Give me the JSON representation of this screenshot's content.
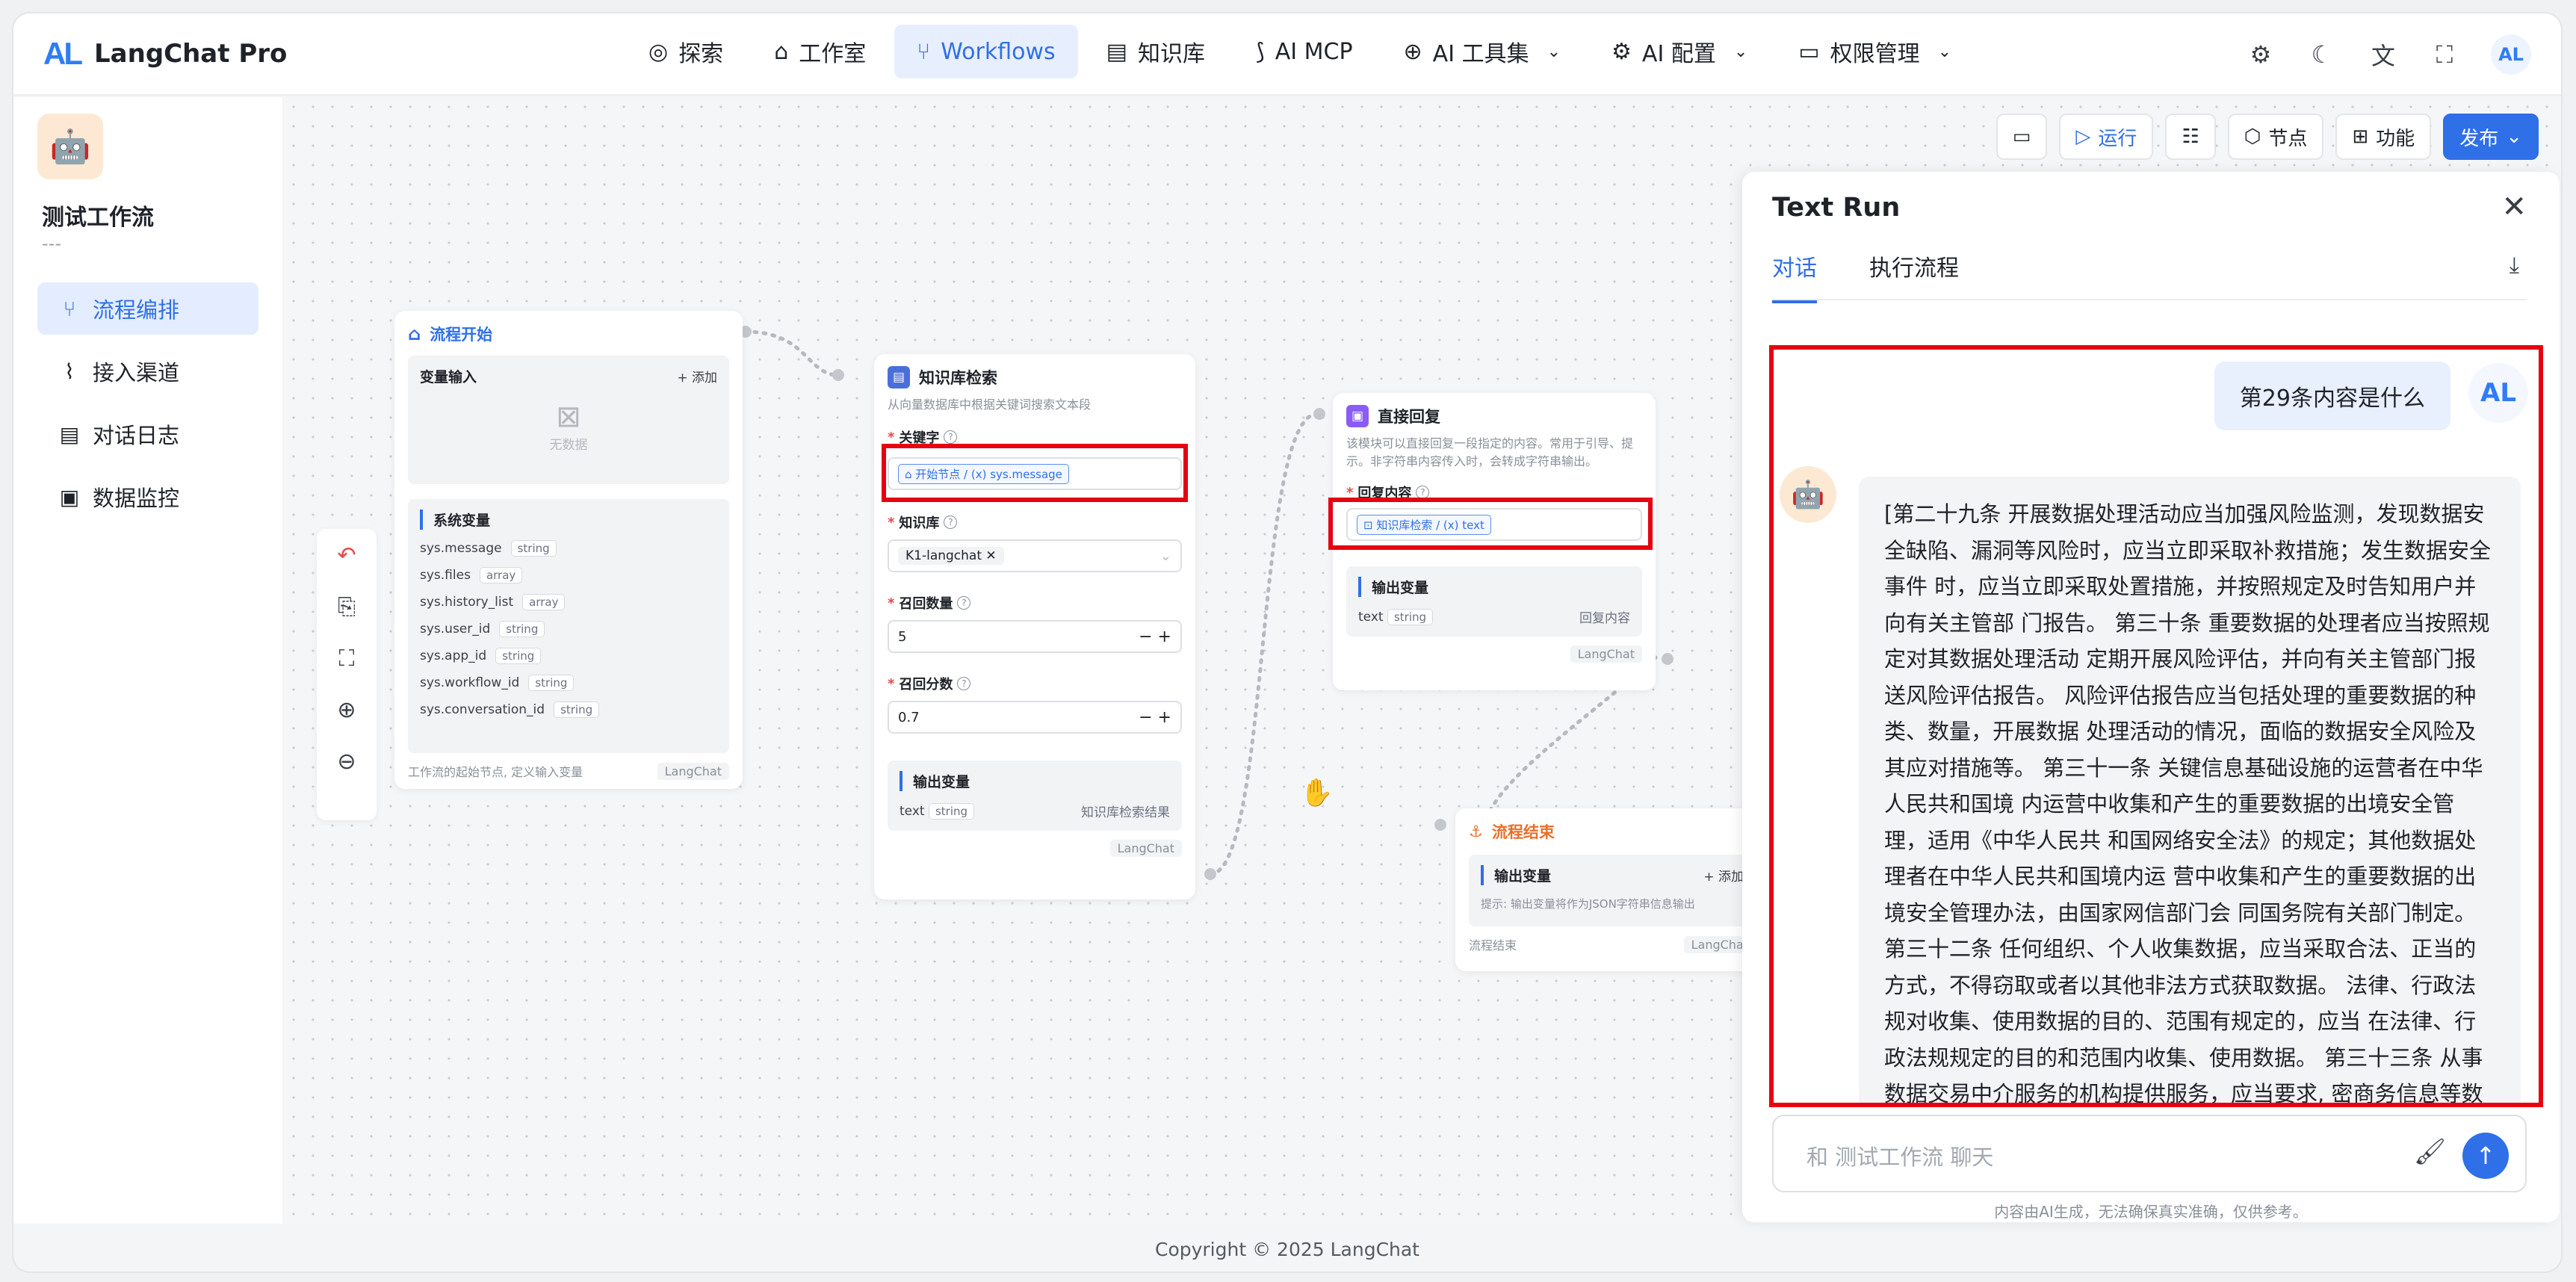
{
  "app": {
    "logo_mark": "AL",
    "name": "LangChat Pro"
  },
  "nav": [
    {
      "icon": "explore-icon",
      "label": "探索"
    },
    {
      "icon": "robot-icon",
      "label": "工作室"
    },
    {
      "icon": "workflow-icon",
      "label": "Workflows",
      "active": true
    },
    {
      "icon": "book-icon",
      "label": "知识库"
    },
    {
      "icon": "mcp-icon",
      "label": "AI MCP"
    },
    {
      "icon": "tools-icon",
      "label": "AI 工具集",
      "dropdown": true
    },
    {
      "icon": "gear-icon",
      "label": "AI 配置",
      "dropdown": true
    },
    {
      "icon": "folder-lock-icon",
      "label": "权限管理",
      "dropdown": true
    }
  ],
  "top_icons": [
    "settings-icon",
    "moon-icon",
    "translate-icon",
    "fullscreen-icon"
  ],
  "user_avatar": "AL",
  "sidebar": {
    "app_name": "测试工作流",
    "app_desc": "---",
    "items": [
      {
        "icon": "flow-edit-icon",
        "label": "流程编排",
        "active": true
      },
      {
        "icon": "rss-icon",
        "label": "接入渠道"
      },
      {
        "icon": "log-icon",
        "label": "对话日志"
      },
      {
        "icon": "monitor-icon",
        "label": "数据监控"
      }
    ]
  },
  "toolbar": {
    "run": "运行",
    "nodes": "节点",
    "features": "功能",
    "publish": "发布"
  },
  "nodes": {
    "start": {
      "title": "流程开始",
      "var_input": "变量输入",
      "add": "+ 添加",
      "empty": "无数据",
      "sys_title": "系统变量",
      "sys_vars": [
        {
          "name": "sys.message",
          "type": "string"
        },
        {
          "name": "sys.files",
          "type": "array"
        },
        {
          "name": "sys.history_list",
          "type": "array"
        },
        {
          "name": "sys.user_id",
          "type": "string"
        },
        {
          "name": "sys.app_id",
          "type": "string"
        },
        {
          "name": "sys.workflow_id",
          "type": "string"
        },
        {
          "name": "sys.conversation_id",
          "type": "string"
        }
      ],
      "footer": "工作流的起始节点, 定义输入变量",
      "footer_tag": "LangChat"
    },
    "kb": {
      "title": "知识库检索",
      "desc": "从向量数据库中根据关键词搜索文本段",
      "keyword_label": "关键字",
      "keyword_ref": "⌂ 开始节点 / (x) sys.message",
      "kb_label": "知识库",
      "kb_value": "K1-langchat",
      "recall_count_label": "召回数量",
      "recall_count": "5",
      "recall_score_label": "召回分数",
      "recall_score": "0.7",
      "output_title": "输出变量",
      "output_var": "text",
      "output_type": "string",
      "output_desc": "知识库检索结果",
      "footer_tag": "LangChat"
    },
    "reply": {
      "title": "直接回复",
      "desc": "该模块可以直接回复一段指定的内容。常用于引导、提示。非字符串内容传入时，会转成字符串输出。",
      "content_label": "回复内容",
      "content_ref": "⊡ 知识库检索 / (x) text",
      "output_title": "输出变量",
      "output_var": "text",
      "output_type": "string",
      "output_desc": "回复内容",
      "footer_tag": "LangChat"
    },
    "end": {
      "title": "流程结束",
      "output_title": "输出变量",
      "add": "+ 添加",
      "hint": "提示: 输出变量将作为JSON字符串信息输出",
      "footer": "流程结束",
      "footer_tag": "LangChat"
    }
  },
  "panel": {
    "title": "Text Run",
    "tabs": [
      {
        "label": "对话",
        "active": true
      },
      {
        "label": "执行流程"
      }
    ],
    "user_message": "第29条内容是什么",
    "bot_message": "[第二十九条 开展数据处理活动应当加强风险监测，发现数据安 全缺陷、漏洞等风险时，应当立即采取补救措施；发生数据安全事件 时，应当立即采取处置措施，并按照规定及时告知用户并向有关主管部 门报告。 第三十条 重要数据的处理者应当按照规定对其数据处理活动 定期开展风险评估，并向有关主管部门报送风险评估报告。 风险评估报告应当包括处理的重要数据的种类、数量，开展数据 处理活动的情况，面临的数据安全风险及其应对措施等。 第三十一条 关键信息基础设施的运营者在中华人民共和国境 内运营中收集和产生的重要数据的出境安全管理，适用《中华人民共 和国网络安全法》的规定；其他数据处理者在中华人民共和国境内运 营中收集和产生的重要数据的出境安全管理办法，由国家网信部门会 同国务院有关部门制定。 第三十二条 任何组织、个人收集数据，应当采取合法、正当的 方式，不得窃取或者以其他非法方式获取数据。 法律、行政法规对收集、使用数据的目的、范围有规定的，应当 在法律、行政法规规定的目的和范围内收集、使用数据。 第三十三条 从事数据交易中介服务的机构提供服务，应当要求, 密商务信息等数据应当依法予以保密，不得泄露或者非法向他人提供。 第三十九条 国家机关应当依照法律、行政法",
    "input_placeholder": "和 测试工作流 聊天",
    "hint": "内容由AI生成，无法确保真实准确，仅供参考。"
  },
  "footer": "Copyright © 2025 LangChat"
}
